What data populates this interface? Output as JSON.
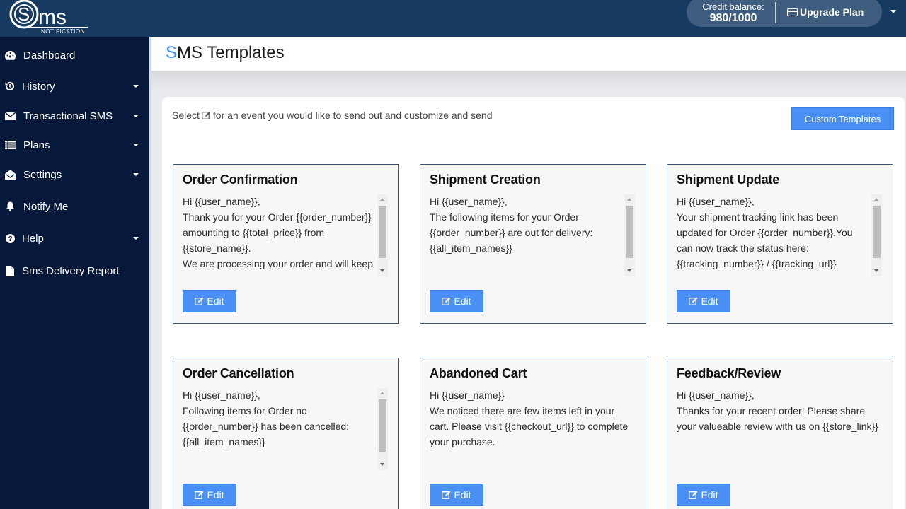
{
  "app": {
    "logo_text": "ms",
    "logo_subtext": "NOTIFICATION"
  },
  "topbar": {
    "credit_label": "Credit balance:",
    "credit_value": "980/1000",
    "upgrade_label": "Upgrade Plan",
    "upgrade_icon": "credit-card-icon"
  },
  "sidebar": {
    "items": [
      {
        "label": "Dashboard",
        "icon": "dashboard-icon",
        "has_submenu": false
      },
      {
        "label": "History",
        "icon": "history-icon",
        "has_submenu": true
      },
      {
        "label": "Transactional SMS",
        "icon": "envelope-icon",
        "has_submenu": true
      },
      {
        "label": "Plans",
        "icon": "list-icon",
        "has_submenu": true
      },
      {
        "label": "Settings",
        "icon": "envelope-open-icon",
        "has_submenu": true
      },
      {
        "label": "Notify Me",
        "icon": "bell-icon",
        "has_submenu": false
      },
      {
        "label": "Help",
        "icon": "question-icon",
        "has_submenu": true
      },
      {
        "label": "Sms Delivery Report",
        "icon": "file-icon",
        "has_submenu": false
      }
    ]
  },
  "header": {
    "title_accent": "S",
    "title_rest": "MS Templates"
  },
  "main": {
    "instruction_prefix": "Select",
    "instruction_suffix": "for an event you would like to send out and customize and send",
    "custom_templates_label": "Custom Templates",
    "edit_label": "Edit",
    "templates": [
      {
        "title": "Order Confirmation",
        "body": "Hi {{user_name}},\nThank you for your Order {{order_number}}\namounting to {{total_price}} from\n{{store_name}}.\nWe are processing your order and will keep\nyou posted.",
        "scrollable": true
      },
      {
        "title": "Shipment Creation",
        "body": "Hi {{user_name}},\nThe following items for your Order\n{{order_number}} are out for delivery:\n{{all_item_names}}\n\n{{store_name}}",
        "scrollable": true
      },
      {
        "title": "Shipment Update",
        "body": "Hi {{user_name}},\nYour shipment tracking link has been\nupdated for Order {{order_number}}.You\ncan now track the status here:\n{{tracking_number}} / {{tracking_url}}\n{{store_name}}",
        "scrollable": true
      },
      {
        "title": "Order Cancellation",
        "body": "Hi {{user_name}},\nFollowing items for Order no\n{{order_number}} has been cancelled:\n{{all_item_names}}\n\n{{store_name}}",
        "scrollable": true
      },
      {
        "title": "Abandoned Cart",
        "body": "Hi {{user_name}}\nWe noticed there are few items left in your\ncart. Please visit {{checkout_url}} to complete\nyour purchase.",
        "scrollable": false
      },
      {
        "title": "Feedback/Review",
        "body": "Hi {{user_name}},\nThanks for your recent order! Please share\nyour valueable review with us on {{store_link}}",
        "scrollable": false
      }
    ]
  },
  "colors": {
    "topbar": "#163a60",
    "sidebar": "#06193a",
    "accent": "#4a90f4",
    "card_border": "#3a5576"
  }
}
